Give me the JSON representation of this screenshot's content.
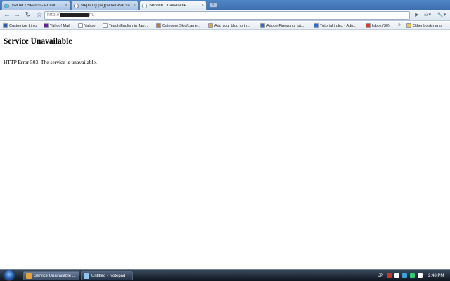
{
  "browser": {
    "tabs": [
      {
        "title": "Twitter / Search - Arman...",
        "close": "×",
        "favicon_color": "#33ccff",
        "active": false
      },
      {
        "title": "steps ng pagpapakasal sa...",
        "close": "×",
        "favicon_color": "#ffffff",
        "active": false
      },
      {
        "title": "Service Unavailable",
        "close": "×",
        "favicon_color": "#ffffff",
        "active": true
      }
    ],
    "new_tab": "+",
    "nav": {
      "back": "←",
      "forward": "→",
      "reload": "↻",
      "star": "☆",
      "go": "▶",
      "page_menu": "▭▾",
      "tools_menu": "🔧▾"
    },
    "url": {
      "prefix": "http://",
      "redacted": true,
      "suffix": "m/"
    },
    "bookmarks": [
      {
        "label": "Customize Links",
        "icon_color": "#2f5fb3"
      },
      {
        "label": "Yahoo! Mail",
        "icon_color": "#6b1fa5"
      },
      {
        "label": "Yahoo!",
        "icon_color": "#ffffff"
      },
      {
        "label": "Teach English in Jap...",
        "icon_color": "#ffffff"
      },
      {
        "label": "Category:Skid/Lame...",
        "icon_color": "#c07a2a"
      },
      {
        "label": "Add your blog to th...",
        "icon_color": "#e0b020"
      },
      {
        "label": "Adobe Fireworks tut...",
        "icon_color": "#2e6fd0"
      },
      {
        "label": "Tutorial index - Ado...",
        "icon_color": "#2e6fd0"
      },
      {
        "label": "Inbox (30)",
        "icon_color": "#d93a2b"
      },
      {
        "label": "Other bookmarks",
        "icon_color": "#e8c45a"
      }
    ],
    "bookmarks_overflow": "»"
  },
  "page": {
    "title": "Service Unavailable",
    "message": "HTTP Error 503. The service is unavailable."
  },
  "taskbar": {
    "tasks": [
      {
        "label": "Service Unavailable ...",
        "icon_color": "#e8a23a",
        "active": true
      },
      {
        "label": "Untitled - Notepad",
        "icon_color": "#8fc4f0",
        "active": false
      }
    ],
    "tray": {
      "language": "JP",
      "clock": "2:48 PM",
      "icon_colors": [
        "#c0392b",
        "#ffffff",
        "#3fa0e0",
        "#2ecc71",
        "#ffffff"
      ]
    }
  }
}
